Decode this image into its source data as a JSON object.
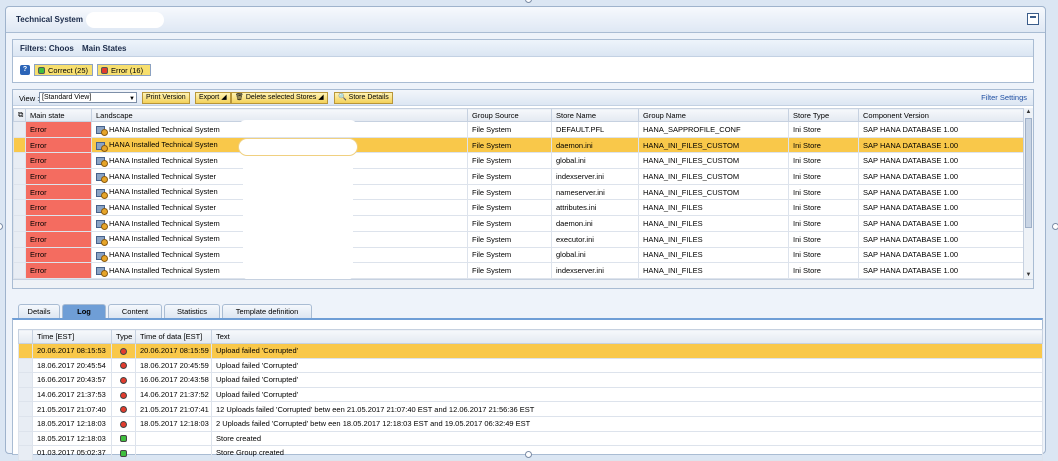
{
  "window": {
    "title": "Technical System"
  },
  "filters": {
    "header": "Filters: Choos",
    "header_suffix": "Main States",
    "help": "?",
    "chips": [
      {
        "label": "Correct (25)",
        "color": "#3fbf3f"
      },
      {
        "label": "Error (16)",
        "color": "#e23c2e"
      }
    ]
  },
  "toolbar": {
    "view_label": "View :",
    "view_value": "[Standard View]",
    "print_version": "Print Version",
    "export": "Export",
    "delete_stores": "Delete selected Stores",
    "store_details": "Store Details",
    "filter_settings": "Filter Settings"
  },
  "stores_table": {
    "columns": [
      "Main state",
      "Landscape",
      "Group Source",
      "Store Name",
      "Group Name",
      "Store Type",
      "Component Version"
    ],
    "rows": [
      {
        "state": "Error",
        "landscape": "HANA Installed Technical System",
        "source": "File System",
        "store": "DEFAULT.PFL",
        "group": "HANA_SAPPROFILE_CONF",
        "type": "Ini Store",
        "version": "SAP HANA DATABASE 1.00"
      },
      {
        "state": "Error",
        "landscape": "HANA Installed Technical Systen",
        "source": "File System",
        "store": "daemon.ini",
        "group": "HANA_INI_FILES_CUSTOM",
        "type": "Ini Store",
        "version": "SAP HANA DATABASE 1.00"
      },
      {
        "state": "Error",
        "landscape": "HANA Installed Technical Systen",
        "source": "File System",
        "store": "global.ini",
        "group": "HANA_INI_FILES_CUSTOM",
        "type": "Ini Store",
        "version": "SAP HANA DATABASE 1.00"
      },
      {
        "state": "Error",
        "landscape": "HANA Installed Technical Syster",
        "source": "File System",
        "store": "indexserver.ini",
        "group": "HANA_INI_FILES_CUSTOM",
        "type": "Ini Store",
        "version": "SAP HANA DATABASE 1.00"
      },
      {
        "state": "Error",
        "landscape": "HANA Installed Technical Systen",
        "source": "File System",
        "store": "nameserver.ini",
        "group": "HANA_INI_FILES_CUSTOM",
        "type": "Ini Store",
        "version": "SAP HANA DATABASE 1.00"
      },
      {
        "state": "Error",
        "landscape": "HANA Installed Technical Syster",
        "source": "File System",
        "store": "attributes.ini",
        "group": "HANA_INI_FILES",
        "type": "Ini Store",
        "version": "SAP HANA DATABASE 1.00"
      },
      {
        "state": "Error",
        "landscape": "HANA Installed Technical System",
        "source": "File System",
        "store": "daemon.ini",
        "group": "HANA_INI_FILES",
        "type": "Ini Store",
        "version": "SAP HANA DATABASE 1.00"
      },
      {
        "state": "Error",
        "landscape": "HANA Installed Technical System",
        "source": "File System",
        "store": "executor.ini",
        "group": "HANA_INI_FILES",
        "type": "Ini Store",
        "version": "SAP HANA DATABASE 1.00"
      },
      {
        "state": "Error",
        "landscape": "HANA Installed Technical System",
        "source": "File System",
        "store": "global.ini",
        "group": "HANA_INI_FILES",
        "type": "Ini Store",
        "version": "SAP HANA DATABASE 1.00"
      },
      {
        "state": "Error",
        "landscape": "HANA Installed Technical System",
        "source": "File System",
        "store": "indexserver.ini",
        "group": "HANA_INI_FILES",
        "type": "Ini Store",
        "version": "SAP HANA DATABASE 1.00"
      }
    ]
  },
  "tabs": [
    "Details",
    "Log",
    "Content",
    "Statistics",
    "Template definition"
  ],
  "log_table": {
    "columns": [
      "Time [EST]",
      "Type",
      "Time of data [EST]",
      "Text"
    ],
    "rows": [
      {
        "time": "20.06.2017 08:15:53",
        "type": "red",
        "data_time": "20.06.2017 08:15:59",
        "text": "Upload failed 'Corrupted'"
      },
      {
        "time": "18.06.2017 20:45:54",
        "type": "red",
        "data_time": "18.06.2017 20:45:59",
        "text": "Upload failed 'Corrupted'"
      },
      {
        "time": "16.06.2017 20:43:57",
        "type": "red",
        "data_time": "16.06.2017 20:43:58",
        "text": "Upload failed 'Corrupted'"
      },
      {
        "time": "14.06.2017 21:37:53",
        "type": "red",
        "data_time": "14.06.2017 21:37:52",
        "text": "Upload failed 'Corrupted'"
      },
      {
        "time": "21.05.2017 21:07:40",
        "type": "red",
        "data_time": "21.05.2017 21:07:41",
        "text": "12 Uploads failed 'Corrupted' betw een 21.05.2017 21:07:40 EST and 12.06.2017 21:56:36 EST"
      },
      {
        "time": "18.05.2017 12:18:03",
        "type": "red",
        "data_time": "18.05.2017 12:18:03",
        "text": "2 Uploads failed 'Corrupted' betw een 18.05.2017 12:18:03 EST and 19.05.2017 06:32:49 EST"
      },
      {
        "time": "18.05.2017 12:18:03",
        "type": "green",
        "data_time": "",
        "text": "Store created"
      },
      {
        "time": "01.03.2017 05:02:37",
        "type": "green",
        "data_time": "",
        "text": "Store Group created"
      }
    ]
  }
}
